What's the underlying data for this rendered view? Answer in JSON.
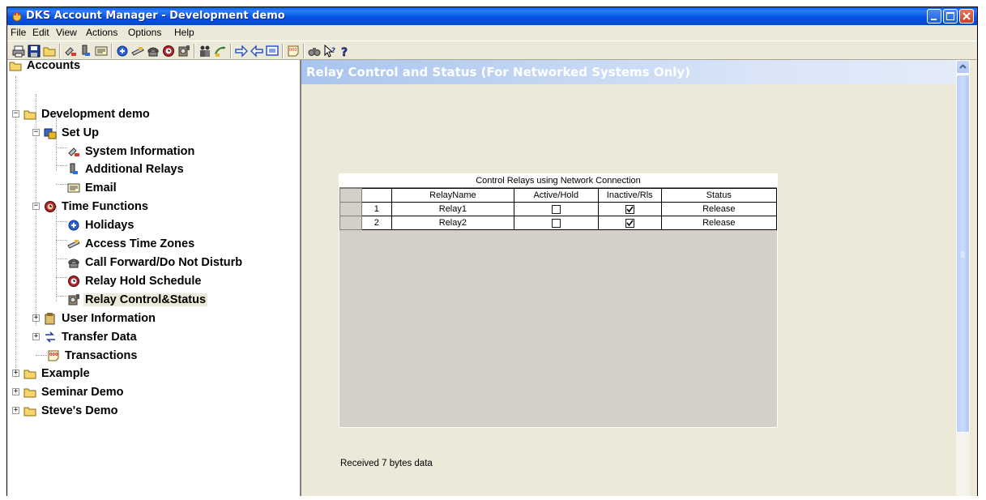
{
  "window": {
    "title": "DKS Account Manager - Development demo",
    "icon": "app-icon",
    "controls": [
      "minimize-icon",
      "maximize-icon",
      "close-icon"
    ]
  },
  "menu": [
    "File",
    "Edit",
    "View",
    "Actions",
    "Options",
    "Help"
  ],
  "toolbar": {
    "icons": [
      "printer-icon",
      "save-icon",
      "folder-icon",
      "system-info-icon",
      "relay-icon",
      "email-icon",
      "holiday-icon",
      "access-zone-icon",
      "phone-icon",
      "schedule-icon",
      "relay-control-icon",
      "users-icon",
      "transfer-icon",
      "arrow-right-icon",
      "arrow-left-icon",
      "monitor-icon",
      "transactions-icon",
      "binoculars-icon",
      "help-pointer-icon",
      "question-icon"
    ]
  },
  "tree": {
    "nodes": [
      {
        "label": "Accounts",
        "icon": "folder-icon"
      },
      {
        "label": "Development demo",
        "icon": "folder-icon"
      },
      {
        "label": "Set Up",
        "icon": "setup-icon"
      },
      {
        "label": "System Information",
        "icon": "system-info-icon"
      },
      {
        "label": "Additional Relays",
        "icon": "relay-icon"
      },
      {
        "label": "Email",
        "icon": "email-icon"
      },
      {
        "label": "Time Functions",
        "icon": "clock-icon"
      },
      {
        "label": "Holidays",
        "icon": "holiday-icon"
      },
      {
        "label": "Access Time Zones",
        "icon": "access-zone-icon"
      },
      {
        "label": "Call Forward/Do Not Disturb",
        "icon": "phone-icon"
      },
      {
        "label": "Relay Hold Schedule",
        "icon": "schedule-icon"
      },
      {
        "label": "Relay Control&Status",
        "icon": "relay-control-icon",
        "selected": true
      },
      {
        "label": "User Information",
        "icon": "user-info-icon"
      },
      {
        "label": "Transfer Data",
        "icon": "transfer-icon"
      },
      {
        "label": "Transactions",
        "icon": "transactions-icon"
      },
      {
        "label": "Example",
        "icon": "folder-icon"
      },
      {
        "label": "Seminar Demo",
        "icon": "folder-icon"
      },
      {
        "label": "Steve's Demo",
        "icon": "folder-icon"
      }
    ]
  },
  "pane": {
    "title": "Relay Control and Status (For Networked Systems Only)",
    "status_message": "Received  7 bytes data"
  },
  "grid": {
    "caption": "Control Relays using Network Connection",
    "columns": [
      "",
      "",
      "RelayName",
      "Active/Hold",
      "Inactive/Rls",
      "Status"
    ],
    "rows": [
      {
        "index": "1",
        "name": "Relay1",
        "active_hold": false,
        "inactive_rls": true,
        "status": "Release"
      },
      {
        "index": "2",
        "name": "Relay2",
        "active_hold": false,
        "inactive_rls": true,
        "status": "Release"
      }
    ]
  }
}
